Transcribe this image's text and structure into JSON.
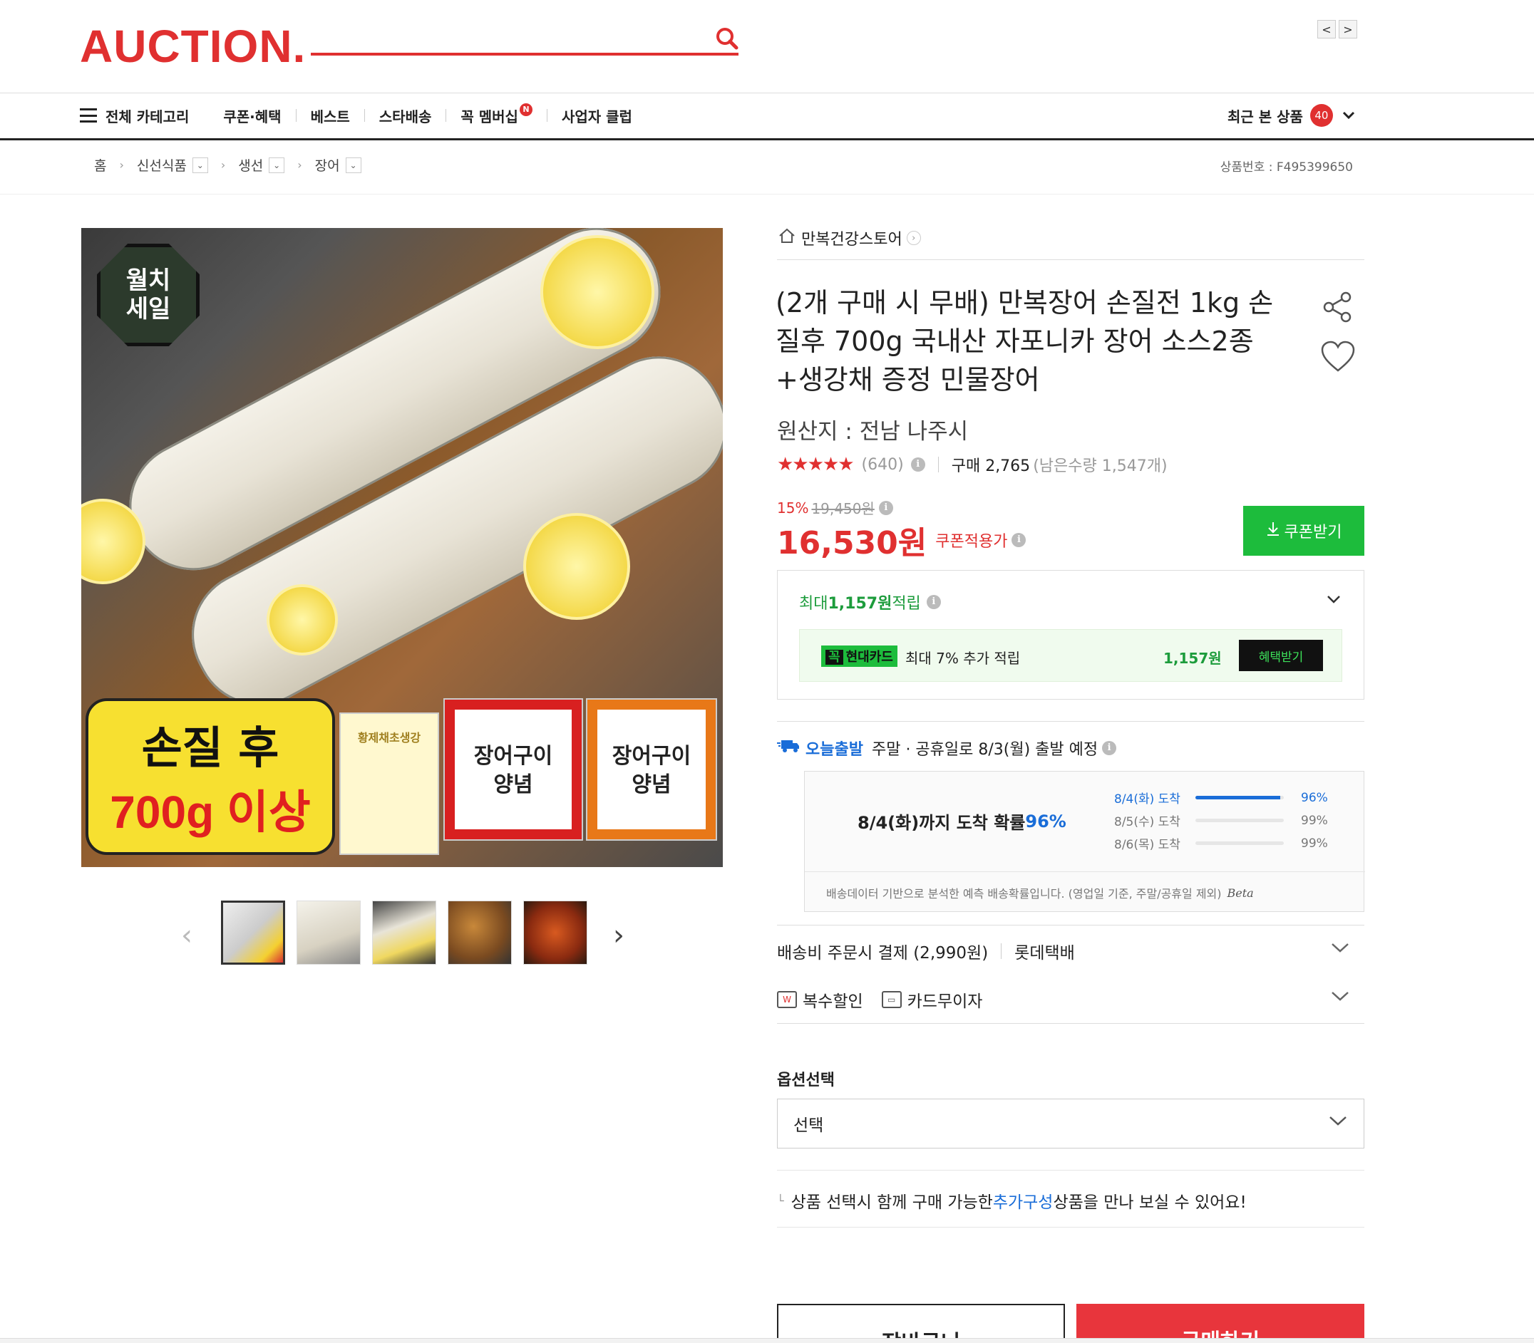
{
  "header": {
    "logo": "AUCTION.",
    "nav_prev": "<",
    "nav_next": ">"
  },
  "gnb": {
    "all_category": "전체 카테고리",
    "items": [
      "쿠폰·혜택",
      "베스트",
      "스타배송",
      "꼭 멤버십",
      "사업자 클럽"
    ],
    "new_badge": "N",
    "recent_label": "최근 본 상품",
    "recent_count": "40"
  },
  "breadcrumb": {
    "home": "홈",
    "levels": [
      "신선식품",
      "생선",
      "장어"
    ],
    "product_no": "상품번호 : F495399650"
  },
  "image": {
    "badge_line1": "월치",
    "badge_line2": "세일",
    "promo_line1": "손질 후",
    "promo_line2": "700g 이상",
    "pack1": "황제채초생강",
    "pack2": "장어구이양념",
    "pack3": "장어구이양념"
  },
  "thumbs": {
    "prev": "‹",
    "next": "›",
    "count": 5
  },
  "product": {
    "store": "만복건강스토어",
    "title": "(2개 구매 시 무배) 만복장어 손질전 1kg 손질후 700g 국내산 자포니카 장어 소스2종+생강채 증정 민물장어",
    "origin": "원산지 : 전남 나주시",
    "stars": "★★★★★",
    "review_count": "(640)",
    "purchase": "구매 2,765",
    "stock": "(남은수량 1,547개)",
    "discount_pct": "15%",
    "original_price": "19,450원",
    "price": "16,530원",
    "price_label": "쿠폰적용가",
    "coupon_button": "쿠폰받기"
  },
  "reward": {
    "title_pre": "최대 ",
    "title_amount": "1,157원",
    "title_post": " 적립",
    "card_logo_prefix": "꼭",
    "card_logo": "현대카드",
    "card_text": "최대 7% 추가 적립",
    "card_amount": "1,157원",
    "card_button": "혜택받기"
  },
  "delivery": {
    "today_label": "오늘출발",
    "today_text": "주말 · 공휴일로 8/3(월) 출발 예정",
    "prob_main_pre": "8/4(화)까지 도착 확률 ",
    "prob_main_pct": "96%",
    "rows": [
      {
        "label": "8/4(화) 도착",
        "pct": "96%",
        "value": 96
      },
      {
        "label": "8/5(수) 도착",
        "pct": "99%",
        "value": 0
      },
      {
        "label": "8/6(목) 도착",
        "pct": "99%",
        "value": 0
      }
    ],
    "note": "배송데이터 기반으로 분석한 예측 배송확률입니다. (영업일 기준, 주말/공휴일 제외)",
    "beta": "Beta",
    "fee": "배송비 주문시 결제 (2,990원)",
    "courier": "롯데택배",
    "multi_discount": "복수할인",
    "card_installment": "카드무이자"
  },
  "options": {
    "title": "옵션선택",
    "select_value": "선택",
    "addon_pre": "상품 선택시 함께 구매 가능한 ",
    "addon_highlight": "추가구성",
    "addon_post": " 상품을 만나 보실 수 있어요!"
  },
  "actions": {
    "cart": "장바구니",
    "buy": "구매하기"
  },
  "colors": {
    "brand_red": "#e03030",
    "coupon_green": "#1dbc3c",
    "delivery_blue": "#1a6dd8"
  }
}
